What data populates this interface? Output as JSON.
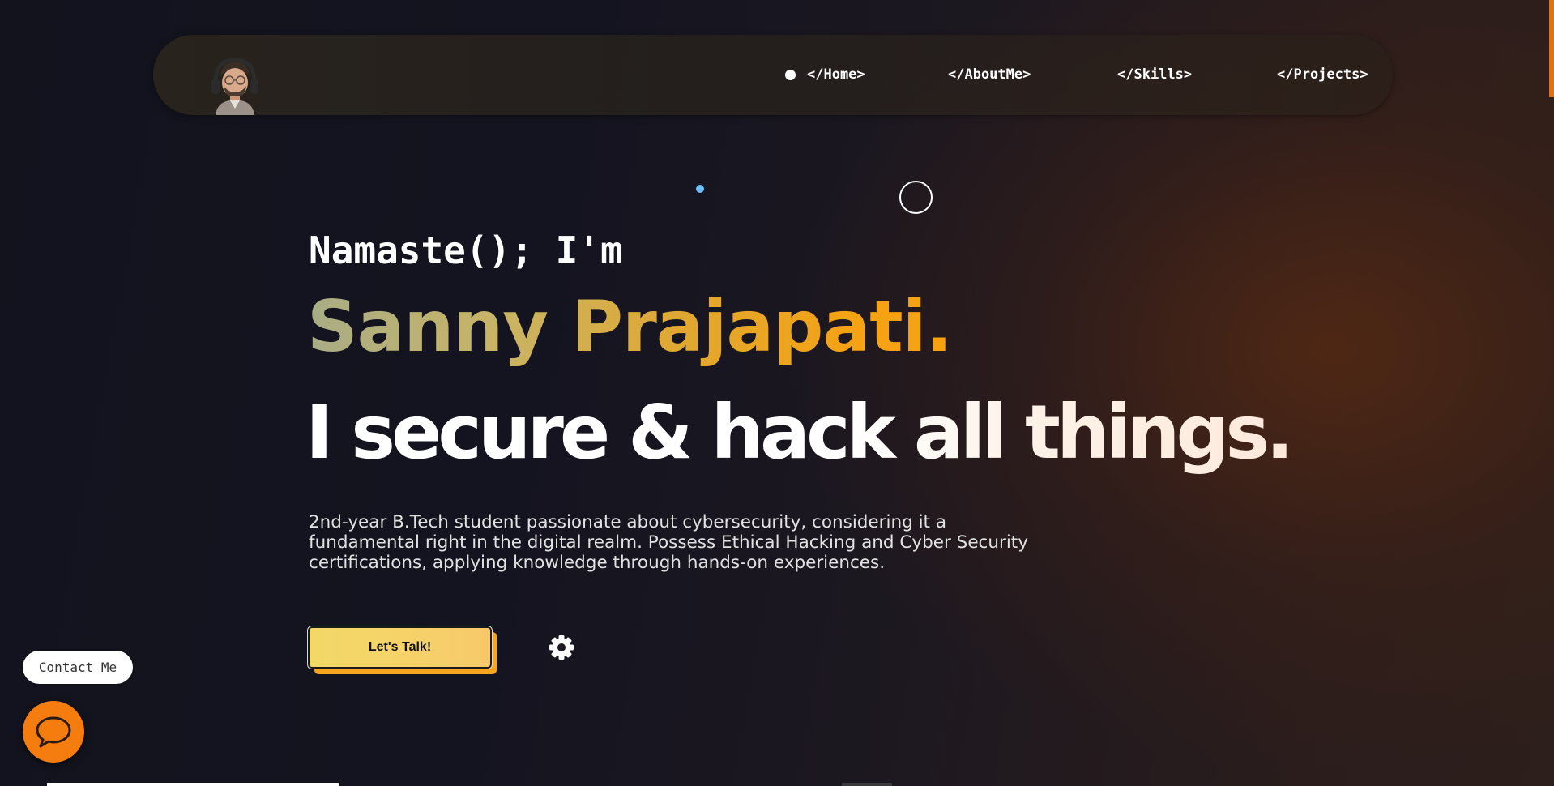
{
  "nav": {
    "items": [
      {
        "label": "</Home>"
      },
      {
        "label": "</AboutMe>"
      },
      {
        "label": "</Skills>"
      },
      {
        "label": "</Projects>"
      }
    ],
    "active_index": 0
  },
  "hero": {
    "greeting": "Namaste(); I'm",
    "name": "Sanny Prajapati.",
    "tagline": "I secure & hack all things.",
    "bio_lines": [
      "2nd-year B.Tech student passionate about cybersecurity, considering it a",
      "fundamental right in the digital realm. Possess Ethical Hacking and Cyber Security",
      "certifications, applying knowledge through hands-on experiences."
    ],
    "cta_label": "Let's Talk!"
  },
  "contact": {
    "pill_label": "Contact Me"
  },
  "icons": {
    "avatar": "avatar-icon",
    "settings": "gear-icon",
    "chat": "chat-bubble-icon"
  },
  "colors": {
    "accent_orange": "#f57c0f",
    "name_gradient_start": "#a8ad86",
    "name_gradient_end": "#f7a310",
    "cta_yellow": "#f2d867",
    "cursor_dot": "#6ec1ff"
  }
}
